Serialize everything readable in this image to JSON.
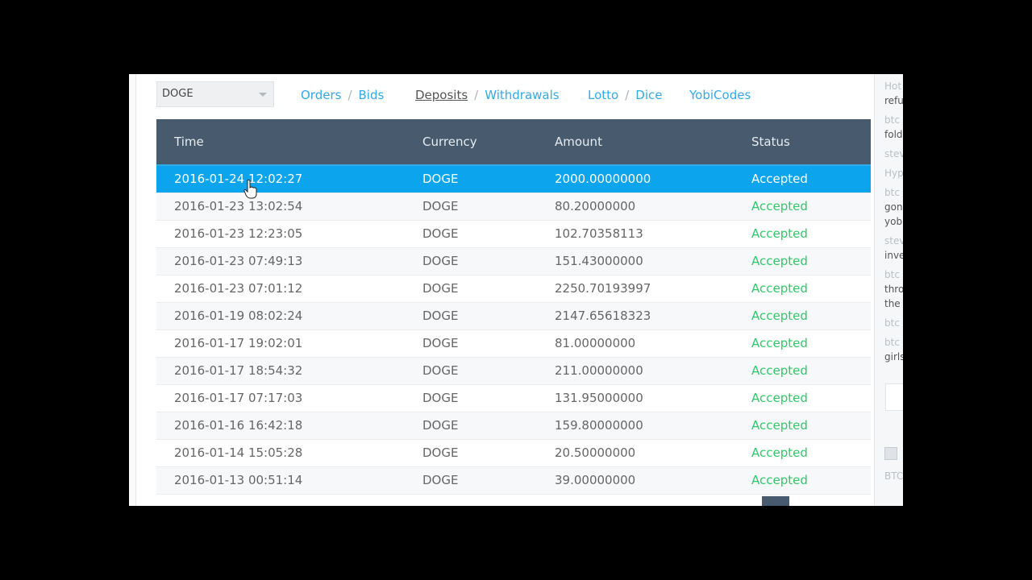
{
  "currency_select": {
    "value": "DOGE"
  },
  "nav": {
    "orders": "Orders",
    "bids": "Bids",
    "deposits": "Deposits",
    "withdrawals": "Withdrawals",
    "lotto": "Lotto",
    "dice": "Dice",
    "yobicodes": "YobiCodes",
    "sep": "/"
  },
  "table": {
    "headers": [
      "Time",
      "Currency",
      "Amount",
      "Status"
    ],
    "rows": [
      {
        "time": "2016-01-24 12:02:27",
        "currency": "DOGE",
        "amount": "2000.00000000",
        "status": "Accepted"
      },
      {
        "time": "2016-01-23 13:02:54",
        "currency": "DOGE",
        "amount": "80.20000000",
        "status": "Accepted"
      },
      {
        "time": "2016-01-23 12:23:05",
        "currency": "DOGE",
        "amount": "102.70358113",
        "status": "Accepted"
      },
      {
        "time": "2016-01-23 07:49:13",
        "currency": "DOGE",
        "amount": "151.43000000",
        "status": "Accepted"
      },
      {
        "time": "2016-01-23 07:01:12",
        "currency": "DOGE",
        "amount": "2250.70193997",
        "status": "Accepted"
      },
      {
        "time": "2016-01-19 08:02:24",
        "currency": "DOGE",
        "amount": "2147.65618323",
        "status": "Accepted"
      },
      {
        "time": "2016-01-17 19:02:01",
        "currency": "DOGE",
        "amount": "81.00000000",
        "status": "Accepted"
      },
      {
        "time": "2016-01-17 18:54:32",
        "currency": "DOGE",
        "amount": "211.00000000",
        "status": "Accepted"
      },
      {
        "time": "2016-01-17 07:17:03",
        "currency": "DOGE",
        "amount": "131.95000000",
        "status": "Accepted"
      },
      {
        "time": "2016-01-16 16:42:18",
        "currency": "DOGE",
        "amount": "159.80000000",
        "status": "Accepted"
      },
      {
        "time": "2016-01-14 15:05:28",
        "currency": "DOGE",
        "amount": "20.50000000",
        "status": "Accepted"
      },
      {
        "time": "2016-01-13 00:51:14",
        "currency": "DOGE",
        "amount": "39.00000000",
        "status": "Accepted"
      }
    ]
  },
  "sidebar": {
    "lines": [
      {
        "kind": "meta",
        "text": "Hot"
      },
      {
        "kind": "msg",
        "text": "refu"
      },
      {
        "kind": "meta",
        "text": "btc"
      },
      {
        "kind": "msg",
        "text": "fold"
      },
      {
        "kind": "meta",
        "text": "stev"
      },
      {
        "kind": "meta",
        "text": "Hyp"
      },
      {
        "kind": "meta",
        "text": "btc"
      },
      {
        "kind": "msg",
        "text": "gon"
      },
      {
        "kind": "msg",
        "text": "yob"
      },
      {
        "kind": "meta",
        "text": "stev"
      },
      {
        "kind": "msg",
        "text": "inve"
      },
      {
        "kind": "meta",
        "text": "btc"
      },
      {
        "kind": "msg",
        "text": "thro"
      },
      {
        "kind": "msg",
        "text": "the"
      },
      {
        "kind": "meta",
        "text": "btc"
      },
      {
        "kind": "meta",
        "text": "btc"
      },
      {
        "kind": "msg",
        "text": "girls"
      },
      {
        "kind": "meta",
        "text": "BTC"
      }
    ]
  },
  "colors": {
    "header_bg": "#485a6e",
    "selected_row": "#0ca4ec",
    "link": "#33a9e8",
    "status_accepted": "#34c66a"
  }
}
